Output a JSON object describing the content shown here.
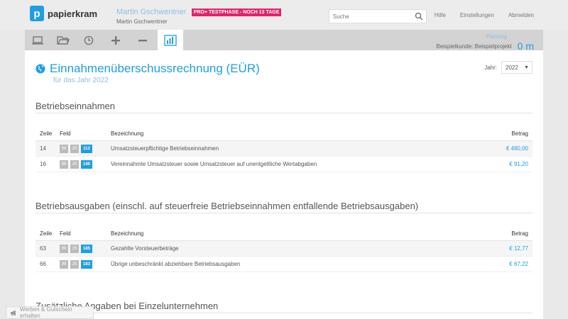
{
  "header": {
    "logo_text": "papierkram",
    "user_name": "Martin Gschwentner",
    "trial_badge": "PRO+ TESTPHASE - NOCH 13 TAGE",
    "user_sub": "Martin Gschwentner",
    "search_placeholder": "Suche",
    "links": [
      "Hilfe",
      "Einstellungen",
      "Abmelden"
    ]
  },
  "toolbar": {
    "icons": [
      "laptop-icon",
      "folder-icon",
      "clock-icon",
      "plus-icon",
      "minus-icon",
      "bar-chart-icon"
    ],
    "active": "bar-chart-icon",
    "planung_label": "Planung",
    "planung_project": "Beispielkunde: Beispielprojekt",
    "planung_time": "0 m"
  },
  "page": {
    "title": "Einnahmenüberschussrechnung (EÜR)",
    "subtitle": "für das Jahr 2022",
    "year_label": "Jahr:",
    "year_value": "2022"
  },
  "sections": [
    {
      "title": "Betriebseinnahmen",
      "headers": {
        "zeile": "Zeile",
        "feld": "Feld",
        "bezeichnung": "Bezeichnung",
        "betrag": "Betrag"
      },
      "rows": [
        {
          "zeile": "14",
          "feld": [
            "99",
            "20",
            "112"
          ],
          "bezeichnung": "Umsatzsteuerpflichtige Betriebseinnahmen",
          "betrag": "€ 480,00"
        },
        {
          "zeile": "16",
          "feld": [
            "99",
            "20",
            "140"
          ],
          "bezeichnung": "Vereinnahmte Umsatzsteuer sowie Umsatzsteuer auf unentgeltliche Wertabgaben",
          "betrag": "€ 91,20"
        }
      ]
    },
    {
      "title": "Betriebsausgaben (einschl. auf steuerfreie Betriebseinnahmen entfallende Betriebsausgaben)",
      "headers": {
        "zeile": "Zeile",
        "feld": "Feld",
        "bezeichnung": "Bezeichnung",
        "betrag": "Betrag"
      },
      "rows": [
        {
          "zeile": "63",
          "feld": [
            "99",
            "25",
            "185"
          ],
          "bezeichnung": "Gezahlte Vorsteuerbeträge",
          "betrag": "€ 12,77"
        },
        {
          "zeile": "66",
          "feld": [
            "99",
            "25",
            "183"
          ],
          "bezeichnung": "Übrige unbeschränkt abziehbare Betriebsausgaben",
          "betrag": "€ 67,22"
        }
      ]
    },
    {
      "title": "Zusätzliche Angaben bei Einzelunternehmen"
    }
  ],
  "promo": {
    "label": "Werben & Gutschein erhalten"
  },
  "colors": {
    "accent": "#1e9ee6",
    "badge": "#e2226a",
    "field_grey": "#bbbbbb"
  }
}
